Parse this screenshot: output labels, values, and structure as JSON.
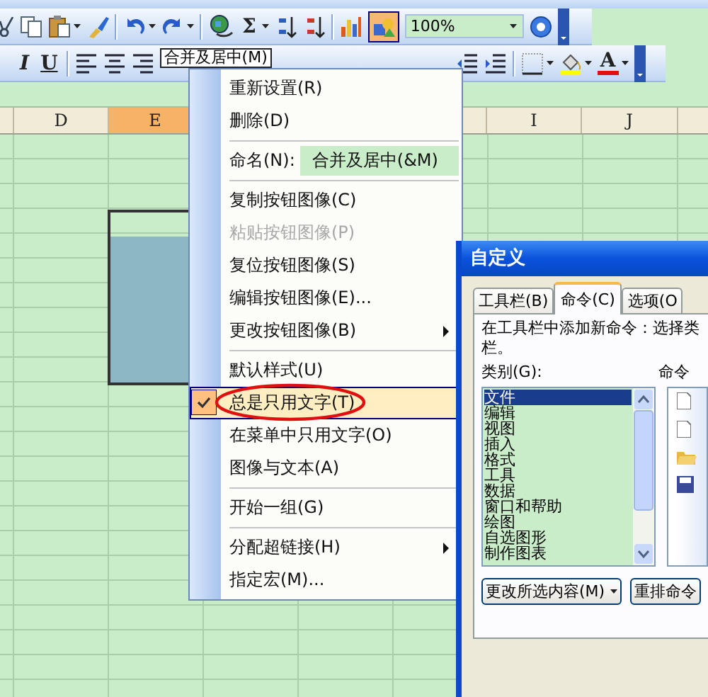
{
  "standard_toolbar": {
    "sum_symbol": "Σ",
    "zoom": "100%",
    "drawing_pressed": true
  },
  "formatting_toolbar": {
    "italic": "I",
    "underline": "U",
    "merge_button": "合并及居中(M)",
    "font_color_letter": "A"
  },
  "columns": [
    {
      "label": "D",
      "selected": false
    },
    {
      "label": "E",
      "selected": true
    },
    {
      "label": "I",
      "selected": false
    },
    {
      "label": "J",
      "selected": false
    }
  ],
  "context_menu": {
    "items": [
      {
        "kind": "item",
        "label": "重新设置(R)",
        "disabled": false,
        "checked": false,
        "selected": false,
        "submenu": false
      },
      {
        "kind": "item",
        "label": "删除(D)",
        "disabled": false,
        "checked": false,
        "selected": false,
        "submenu": false
      },
      {
        "kind": "separator"
      },
      {
        "kind": "name_field",
        "label": "命名(N):",
        "value": "合并及居中(&M)"
      },
      {
        "kind": "separator"
      },
      {
        "kind": "item",
        "label": "复制按钮图像(C)",
        "disabled": false,
        "checked": false,
        "selected": false,
        "submenu": false
      },
      {
        "kind": "item",
        "label": "粘贴按钮图像(P)",
        "disabled": true,
        "checked": false,
        "selected": false,
        "submenu": false
      },
      {
        "kind": "item",
        "label": "复位按钮图像(S)",
        "disabled": false,
        "checked": false,
        "selected": false,
        "submenu": false
      },
      {
        "kind": "item",
        "label": "编辑按钮图像(E)...",
        "disabled": false,
        "checked": false,
        "selected": false,
        "submenu": false
      },
      {
        "kind": "item",
        "label": "更改按钮图像(B)",
        "disabled": false,
        "checked": false,
        "selected": false,
        "submenu": true
      },
      {
        "kind": "separator"
      },
      {
        "kind": "item",
        "label": "默认样式(U)",
        "disabled": false,
        "checked": false,
        "selected": false,
        "submenu": false
      },
      {
        "kind": "item",
        "label": "总是只用文字(T)",
        "disabled": false,
        "checked": true,
        "selected": true,
        "submenu": false
      },
      {
        "kind": "item",
        "label": "在菜单中只用文字(O)",
        "disabled": false,
        "checked": false,
        "selected": false,
        "submenu": false
      },
      {
        "kind": "item",
        "label": "图像与文本(A)",
        "disabled": false,
        "checked": false,
        "selected": false,
        "submenu": false
      },
      {
        "kind": "separator"
      },
      {
        "kind": "item",
        "label": "开始一组(G)",
        "disabled": false,
        "checked": false,
        "selected": false,
        "submenu": false
      },
      {
        "kind": "separator"
      },
      {
        "kind": "item",
        "label": "分配超链接(H)",
        "disabled": false,
        "checked": false,
        "selected": false,
        "submenu": true
      },
      {
        "kind": "item",
        "label": "指定宏(M)...",
        "disabled": false,
        "checked": false,
        "selected": false,
        "submenu": false
      }
    ]
  },
  "dialog": {
    "title": "自定义",
    "tabs": [
      {
        "label": "工具栏(B)",
        "selected": false
      },
      {
        "label": "命令(C)",
        "selected": true
      },
      {
        "label": "选项(O",
        "selected": false
      }
    ],
    "description_lines": [
      "在工具栏中添加新命令：选择类",
      "栏。"
    ],
    "categories_label": "类别(G):",
    "commands_label": "命令",
    "categories": [
      {
        "label": "文件",
        "selected": true
      },
      {
        "label": "编辑",
        "selected": false
      },
      {
        "label": "视图",
        "selected": false
      },
      {
        "label": "插入",
        "selected": false
      },
      {
        "label": "格式",
        "selected": false
      },
      {
        "label": "工具",
        "selected": false
      },
      {
        "label": "数据",
        "selected": false
      },
      {
        "label": "窗口和帮助",
        "selected": false
      },
      {
        "label": "绘图",
        "selected": false
      },
      {
        "label": "自选图形",
        "selected": false
      },
      {
        "label": "制作图表",
        "selected": false
      }
    ],
    "buttons": [
      {
        "label": "更改所选内容(M)",
        "dropdown": true
      },
      {
        "label": "重排命令",
        "dropdown": false
      }
    ]
  }
}
